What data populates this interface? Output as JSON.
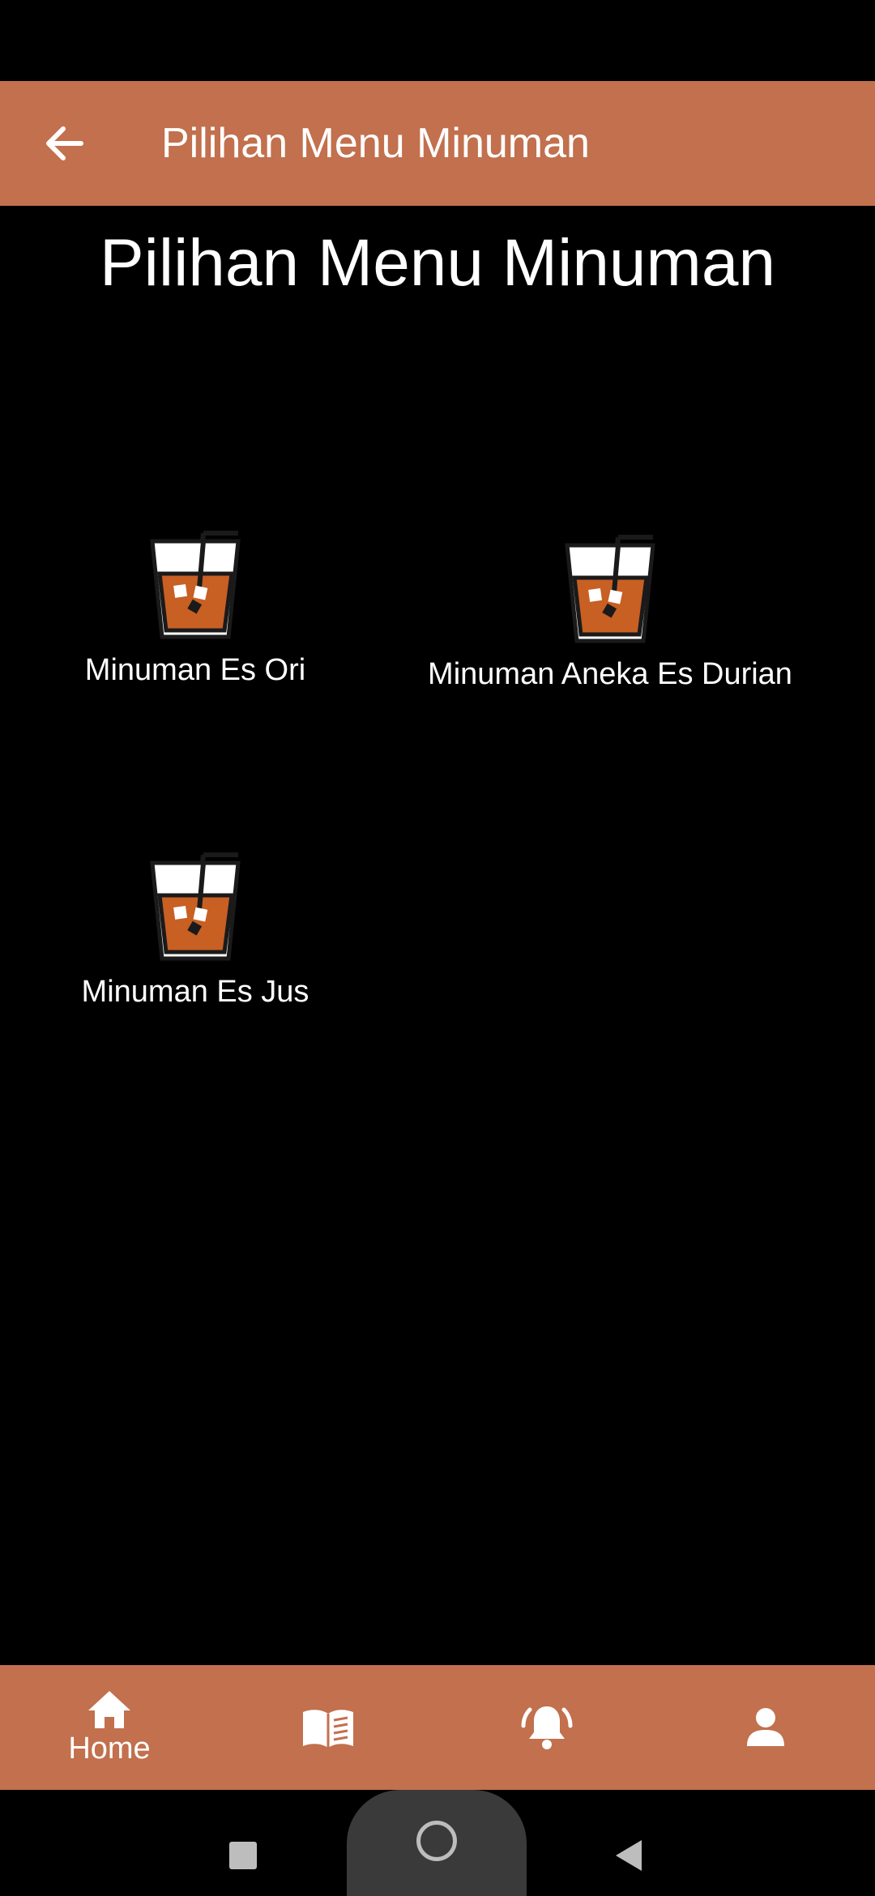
{
  "app_bar": {
    "title": "Pilihan Menu Minuman",
    "back_icon": "arrow-left-icon"
  },
  "heading": "Pilihan Menu Minuman",
  "menu_items": [
    {
      "label": "Minuman Es Ori",
      "icon": "iced-drink-icon"
    },
    {
      "label": "Minuman Aneka Es Durian",
      "icon": "iced-drink-icon"
    },
    {
      "label": "Minuman Es Jus",
      "icon": "iced-drink-icon"
    }
  ],
  "bottom_nav": [
    {
      "label": "Home",
      "icon": "home-icon"
    },
    {
      "label": "",
      "icon": "menu-book-icon"
    },
    {
      "label": "",
      "icon": "notification-bell-icon"
    },
    {
      "label": "",
      "icon": "profile-icon"
    }
  ],
  "colors": {
    "accent": "#C2704D",
    "background": "#000000",
    "drink": "#C85F23"
  }
}
